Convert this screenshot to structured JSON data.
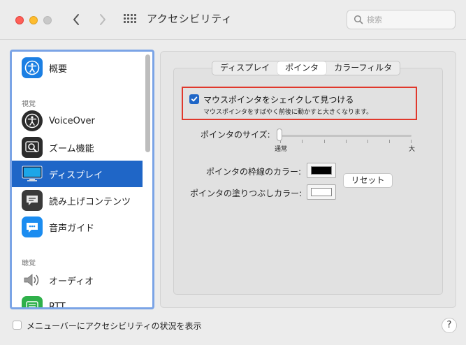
{
  "window": {
    "title": "アクセシビリティ"
  },
  "search": {
    "placeholder": "検索"
  },
  "sidebar": {
    "items": [
      {
        "label": "概要"
      },
      {
        "header": "視覚"
      },
      {
        "label": "VoiceOver"
      },
      {
        "label": "ズーム機能"
      },
      {
        "label": "ディスプレイ",
        "selected": true
      },
      {
        "label": "読み上げコンテンツ"
      },
      {
        "label": "音声ガイド"
      },
      {
        "header": "聴覚"
      },
      {
        "label": "オーディオ"
      },
      {
        "label": "RTT"
      }
    ]
  },
  "tabs": [
    "ディスプレイ",
    "ポインタ",
    "カラーフィルタ"
  ],
  "active_tab": "ポインタ",
  "pointer": {
    "shake_label": "マウスポインタをシェイクして見つける",
    "shake_desc": "マウスポインタをすばやく前後に動かすと大きくなります。",
    "shake_checked": true,
    "size_label": "ポインタのサイズ:",
    "size_min": "通常",
    "size_max": "大",
    "size_value": 0,
    "outline_label": "ポインタの枠線のカラー:",
    "outline_color": "#000000",
    "fill_label": "ポインタの塗りつぶしカラー:",
    "fill_color": "#ffffff",
    "reset_label": "リセット"
  },
  "footer": {
    "menubar_label": "メニューバーにアクセシビリティの状況を表示",
    "help_label": "?"
  },
  "colors": {
    "accent": "#1f66c7",
    "highlight_box": "#e0382c"
  }
}
